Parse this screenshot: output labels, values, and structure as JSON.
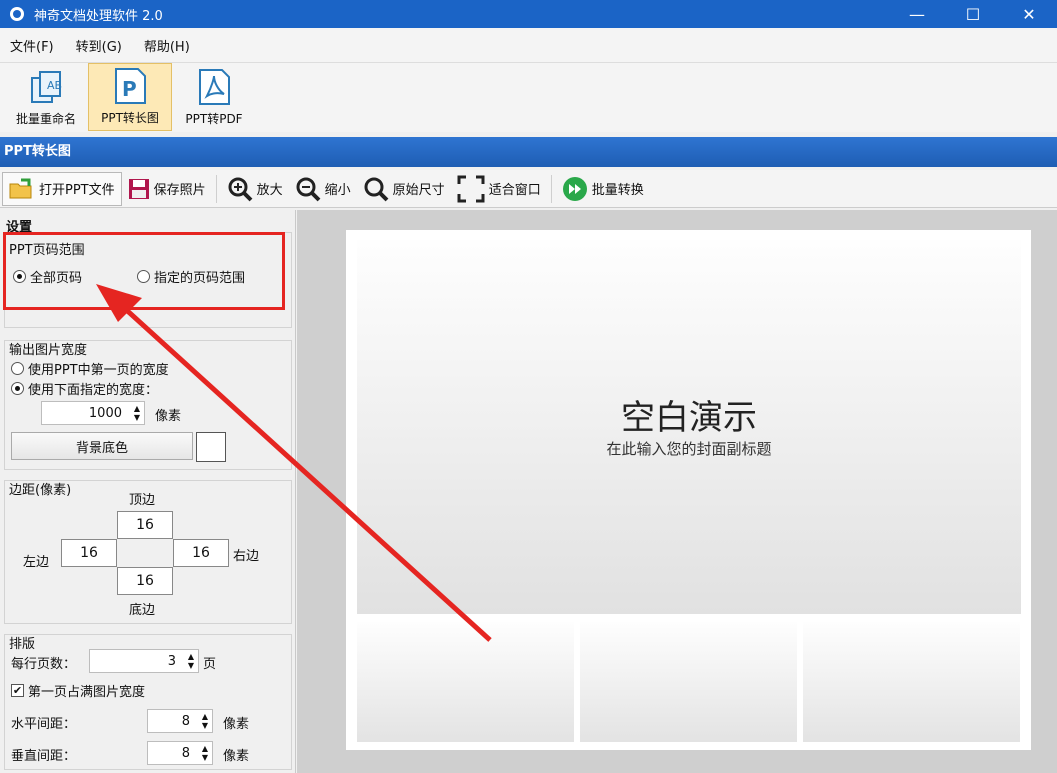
{
  "window": {
    "title": "神奇文档处理软件 2.0",
    "minimize": "—",
    "maximize": "☐",
    "close": "✕"
  },
  "menu": [
    "文件(F)",
    "转到(G)",
    "帮助(H)"
  ],
  "ribbon": [
    {
      "label": "批量重命名",
      "icon": "batch-rename-icon"
    },
    {
      "label": "PPT转长图",
      "icon": "ppt-icon"
    },
    {
      "label": "PPT转PDF",
      "icon": "pdf-icon"
    }
  ],
  "section_title": "PPT转长图",
  "toolbar": {
    "open": "打开PPT文件",
    "save": "保存照片",
    "zoom_in": "放大",
    "zoom_out": "缩小",
    "original_size": "原始尺寸",
    "fit_window": "适合窗口",
    "batch_convert": "批量转换"
  },
  "settings": {
    "head": "设置",
    "page_range": {
      "title": "PPT页码范围",
      "all": "全部页码",
      "custom": "指定的页码范围"
    },
    "output_width": {
      "title": "输出图片宽度",
      "use_first": "使用PPT中第一页的宽度",
      "use_below": "使用下面指定的宽度：",
      "width_value": "1000",
      "unit": "像素",
      "bg_color": "背景底色",
      "bg_swatch": "#ffffff"
    },
    "margins": {
      "title": "边距(像素)",
      "top_label": "顶边",
      "bottom_label": "底边",
      "left_label": "左边",
      "right_label": "右边",
      "top": "16",
      "bottom": "16",
      "left": "16",
      "right": "16"
    },
    "layout": {
      "title": "排版",
      "per_row_label": "每行页数：",
      "per_row": "3",
      "per_row_unit": "页",
      "first_full": "第一页占满图片宽度",
      "h_gap_label": "水平间距：",
      "h_gap": "8",
      "v_gap_label": "垂直间距：",
      "v_gap": "8",
      "gap_unit": "像素"
    }
  },
  "preview": {
    "slide_title": "空白演示",
    "slide_subtitle": "在此输入您的封面副标题"
  },
  "colors": {
    "title_bar": "#1b64c6",
    "highlight": "#e52521"
  }
}
